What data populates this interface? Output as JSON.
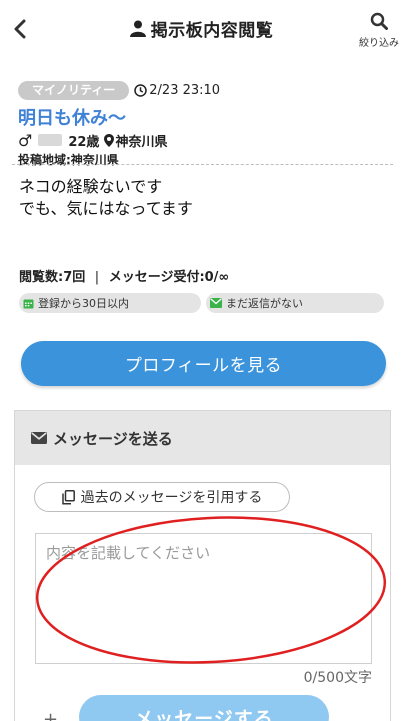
{
  "header": {
    "title": "掲示板内容閲覧",
    "filter_label": "絞り込み"
  },
  "post": {
    "category": "マイノリティー",
    "datetime": "2/23 23:10",
    "title": "明日も休み〜",
    "gender_symbol": "♂",
    "age": "22歳",
    "location": "神奈川県",
    "region_label": "投稿地域:神奈川県",
    "body_lines": [
      "ネコの経験ないです",
      "でも、気にはなってます"
    ],
    "views": "閲覧数:7回",
    "separator": "|",
    "message_status": "メッセージ受付:0/∞",
    "chips": [
      "登録から30日以内",
      "まだ返信がない"
    ]
  },
  "actions": {
    "profile_button": "プロフィールを見る"
  },
  "message": {
    "header": "メッセージを送る",
    "quote_button": "過去のメッセージを引用する",
    "placeholder": "内容を記載してください",
    "counter": "0/500文字",
    "send_button": "メッセージする",
    "send_prefix": "+"
  },
  "colors": {
    "accent_blue": "#3b93dc",
    "title_blue": "#3f82d6",
    "chip_green": "#3bb34a",
    "annotation_red": "#e02020"
  },
  "icons": [
    "back-chevron-icon",
    "user-icon",
    "search-icon",
    "clock-icon",
    "male-icon",
    "pin-icon",
    "calendar-icon",
    "mail-icon",
    "copy-icon"
  ]
}
